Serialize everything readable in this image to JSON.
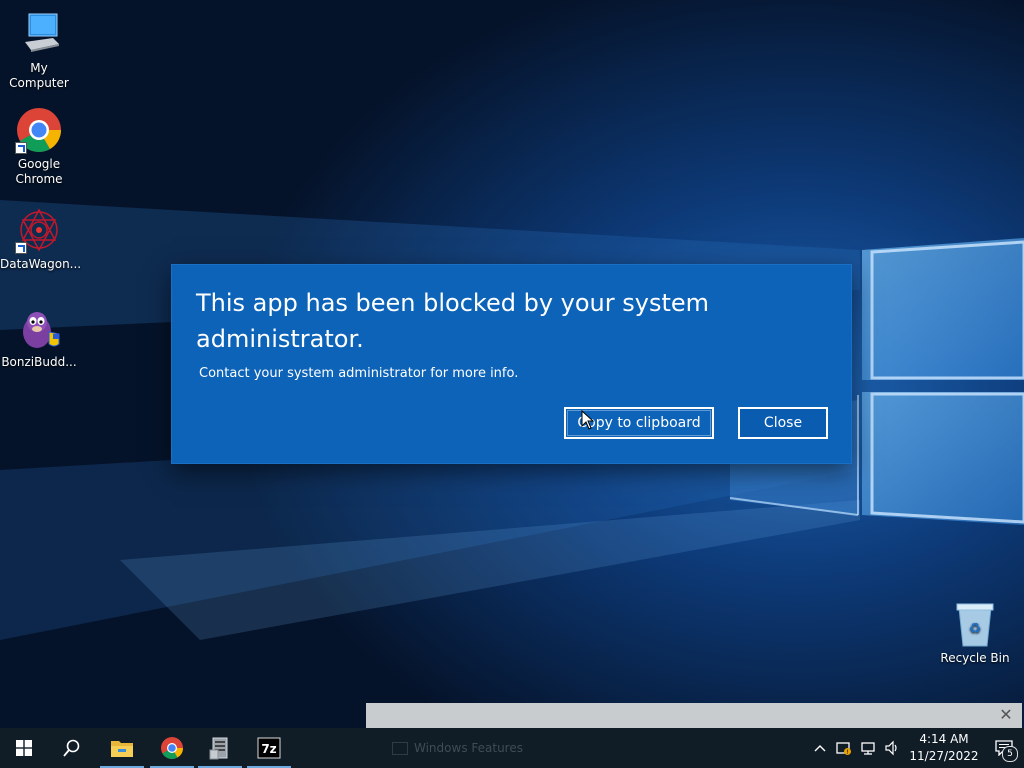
{
  "desktop": {
    "icons": [
      {
        "label": "My Computer"
      },
      {
        "label": "Google Chrome"
      },
      {
        "label": "DataWagon..."
      },
      {
        "label": "BonziBudd..."
      },
      {
        "label": "Recycle Bin"
      }
    ]
  },
  "dialog": {
    "title": "This app has been blocked by your system administrator.",
    "message": "Contact your system administrator for more info.",
    "copy_label": "Copy to clipboard",
    "close_label": "Close",
    "background": "#0d63b8"
  },
  "notification": {
    "close_icon": "close-icon"
  },
  "taskbar": {
    "running_label": "Windows Features",
    "tray": {
      "time": "4:14 AM",
      "date": "11/27/2022",
      "notification_count": "5"
    },
    "icons": [
      "start-icon",
      "search-icon",
      "file-explorer-icon",
      "chrome-icon",
      "server-manager-icon",
      "7zip-icon"
    ]
  }
}
